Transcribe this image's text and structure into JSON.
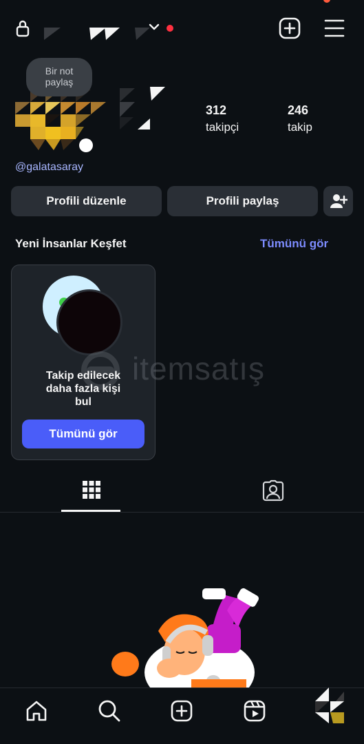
{
  "profile": {
    "note_text": "Bir not paylaş",
    "followers_count": "312",
    "followers_label": "takipçi",
    "following_count": "246",
    "following_label": "takip",
    "threads_handle": "@galatasaray"
  },
  "actions": {
    "edit_label": "Profili düzenle",
    "share_label": "Profili paylaş"
  },
  "discover": {
    "title": "Yeni İnsanlar Keşfet",
    "see_all": "Tümünü gör",
    "card_text": "Takip edilecek daha fazla kişi bul",
    "card_button": "Tümünü gör"
  },
  "watermark": "itemsatış",
  "icons": {
    "top": [
      "lock-icon",
      "chevron-down-icon",
      "new-post-icon",
      "menu-icon"
    ],
    "tabs": [
      "grid-icon",
      "tagged-icon"
    ],
    "nav": [
      "home-icon",
      "search-icon",
      "create-icon",
      "reels-icon",
      "profile-avatar"
    ]
  },
  "colors": {
    "background": "#0c1014",
    "button": "#2a2f36",
    "accent": "#4a5df9",
    "link": "#7d8cff",
    "notification": "#ff3040"
  }
}
